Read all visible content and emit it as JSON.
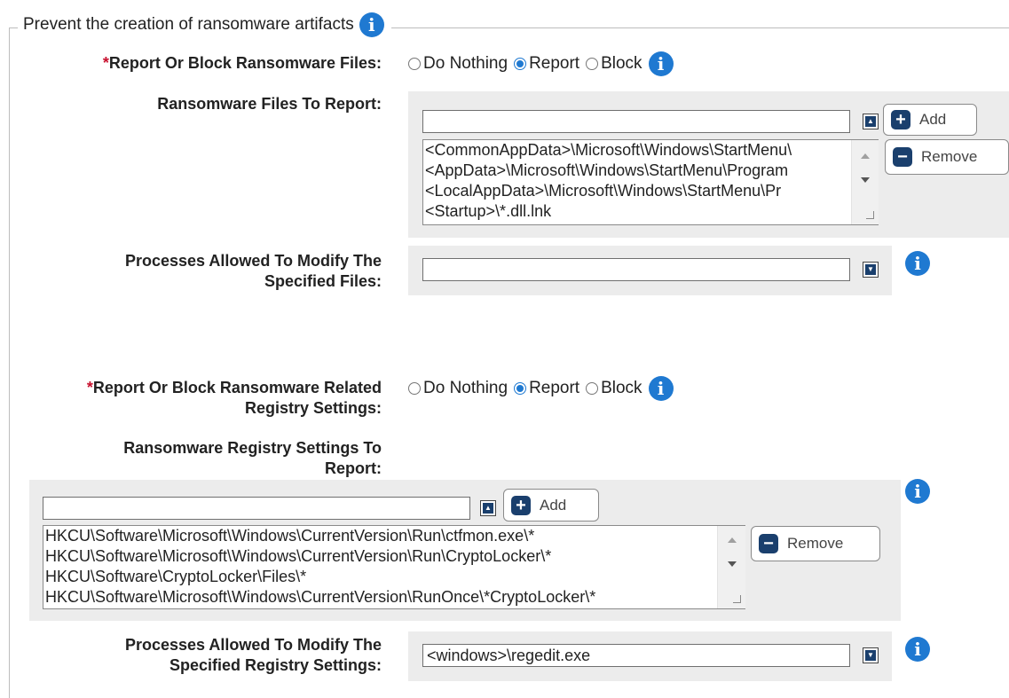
{
  "section": {
    "title": "Prevent the creation of ransomware artifacts"
  },
  "files": {
    "report_label": "Report Or Block Ransomware Files:",
    "required_mark": "*",
    "radio_options": [
      "Do Nothing",
      "Report",
      "Block"
    ],
    "selected": "Report",
    "list_label": "Ransomware Files To Report:",
    "input_value": "",
    "add_label": "Add",
    "remove_label": "Remove",
    "list_items": [
      "<CommonAppData>\\Microsoft\\Windows\\StartMenu\\",
      "<AppData>\\Microsoft\\Windows\\StartMenu\\Program",
      "<LocalAppData>\\Microsoft\\Windows\\StartMenu\\Pr",
      "<Startup>\\*.dll.lnk"
    ],
    "processes_label_line1": "Processes Allowed To Modify The",
    "processes_label_line2": "Specified Files:",
    "processes_value": ""
  },
  "registry": {
    "report_label_line1": "Report Or Block Ransomware Related",
    "report_label_line2": "Registry Settings:",
    "required_mark": "*",
    "radio_options": [
      "Do Nothing",
      "Report",
      "Block"
    ],
    "selected": "Report",
    "list_label_line1": "Ransomware Registry Settings To",
    "list_label_line2": "Report:",
    "input_value": "",
    "add_label": "Add",
    "remove_label": "Remove",
    "list_items": [
      "HKCU\\Software\\Microsoft\\Windows\\CurrentVersion\\Run\\ctfmon.exe\\*",
      "HKCU\\Software\\Microsoft\\Windows\\CurrentVersion\\Run\\CryptoLocker\\*",
      "HKCU\\Software\\CryptoLocker\\Files\\*",
      "HKCU\\Software\\Microsoft\\Windows\\CurrentVersion\\RunOnce\\*CryptoLocker\\*"
    ],
    "processes_label_line1": "Processes Allowed To Modify The",
    "processes_label_line2": "Specified Registry Settings:",
    "processes_value": "<windows>\\regedit.exe"
  },
  "icons": {
    "info": "info-icon",
    "add": "plus-icon",
    "remove": "minus-icon",
    "expand_up": "caret-up-icon",
    "expand_down": "caret-down-icon"
  },
  "colors": {
    "info_blue": "#1f79d1",
    "button_navy": "#1a3f6d",
    "required_red": "#c8102e",
    "panel_gray": "#ececec"
  }
}
